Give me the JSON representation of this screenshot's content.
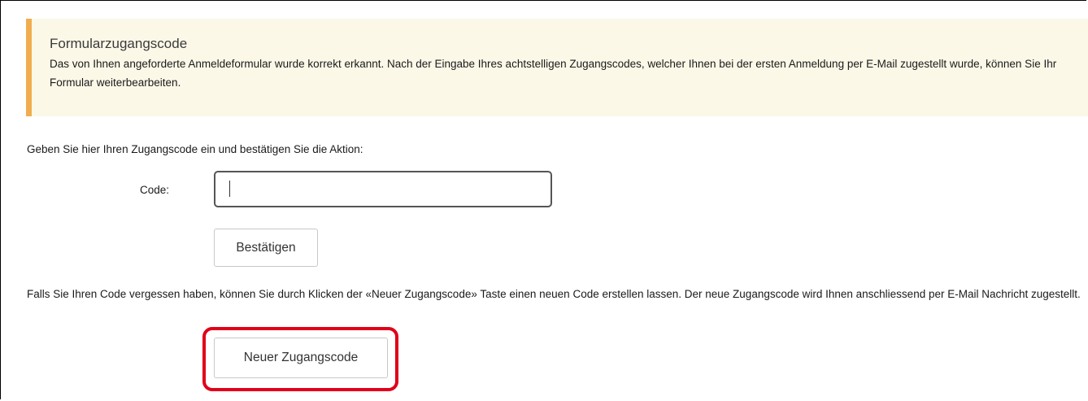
{
  "notice": {
    "title": "Formularzugangscode",
    "text": "Das von Ihnen angeforderte Anmeldeformular wurde korrekt erkannt. Nach der Eingabe Ihres achtstelligen Zugangscodes, welcher Ihnen bei der ersten Anmeldung per E-Mail zugestellt wurde, können Sie Ihr Formular weiterbearbeiten.",
    "accent_color": "#f0ad4e",
    "background_color": "#fcf8e8"
  },
  "form": {
    "instruction": "Geben Sie hier Ihren Zugangscode ein und bestätigen Sie die Aktion:",
    "code_label": "Code:",
    "code_value": "",
    "confirm_label": "Bestätigen"
  },
  "forgot": {
    "text": "Falls Sie Ihren Code vergessen haben, können Sie durch Klicken der «Neuer Zugangscode» Taste einen neuen Code erstellen lassen. Der neue Zugangscode wird Ihnen anschliessend per E-Mail Nachricht zugestellt.",
    "new_code_label": "Neuer Zugangscode",
    "highlight_color": "#e0001a"
  }
}
